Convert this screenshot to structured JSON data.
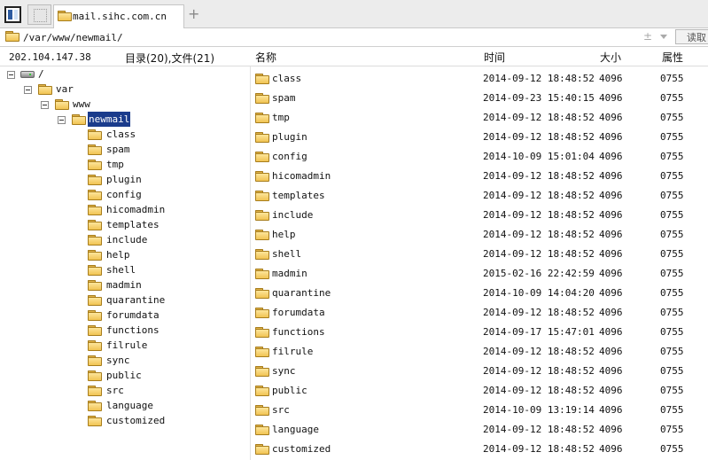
{
  "tabs": {
    "active_title": "mail.sihc.com.cn",
    "new_tab_glyph": "+"
  },
  "address": {
    "path": "/var/www/newmail/",
    "plus_minus": "±",
    "read_button": "读取"
  },
  "header": {
    "ip": "202.104.147.38",
    "counts": "目录(20),文件(21)",
    "col_name": "名称",
    "col_time": "时间",
    "col_size": "大小",
    "col_perm": "属性"
  },
  "tree": {
    "root": "/",
    "var": "var",
    "www": "www",
    "newmail": "newmail",
    "children": [
      "class",
      "spam",
      "tmp",
      "plugin",
      "config",
      "hicomadmin",
      "templates",
      "include",
      "help",
      "shell",
      "madmin",
      "quarantine",
      "forumdata",
      "functions",
      "filrule",
      "sync",
      "public",
      "src",
      "language",
      "customized"
    ]
  },
  "files": [
    {
      "name": "class",
      "time": "2014-09-12 18:48:52",
      "size": "4096",
      "perm": "0755"
    },
    {
      "name": "spam",
      "time": "2014-09-23 15:40:15",
      "size": "4096",
      "perm": "0755"
    },
    {
      "name": "tmp",
      "time": "2014-09-12 18:48:52",
      "size": "4096",
      "perm": "0755"
    },
    {
      "name": "plugin",
      "time": "2014-09-12 18:48:52",
      "size": "4096",
      "perm": "0755"
    },
    {
      "name": "config",
      "time": "2014-10-09 15:01:04",
      "size": "4096",
      "perm": "0755"
    },
    {
      "name": "hicomadmin",
      "time": "2014-09-12 18:48:52",
      "size": "4096",
      "perm": "0755"
    },
    {
      "name": "templates",
      "time": "2014-09-12 18:48:52",
      "size": "4096",
      "perm": "0755"
    },
    {
      "name": "include",
      "time": "2014-09-12 18:48:52",
      "size": "4096",
      "perm": "0755"
    },
    {
      "name": "help",
      "time": "2014-09-12 18:48:52",
      "size": "4096",
      "perm": "0755"
    },
    {
      "name": "shell",
      "time": "2014-09-12 18:48:52",
      "size": "4096",
      "perm": "0755"
    },
    {
      "name": "madmin",
      "time": "2015-02-16 22:42:59",
      "size": "4096",
      "perm": "0755"
    },
    {
      "name": "quarantine",
      "time": "2014-10-09 14:04:20",
      "size": "4096",
      "perm": "0755"
    },
    {
      "name": "forumdata",
      "time": "2014-09-12 18:48:52",
      "size": "4096",
      "perm": "0755"
    },
    {
      "name": "functions",
      "time": "2014-09-17 15:47:01",
      "size": "4096",
      "perm": "0755"
    },
    {
      "name": "filrule",
      "time": "2014-09-12 18:48:52",
      "size": "4096",
      "perm": "0755"
    },
    {
      "name": "sync",
      "time": "2014-09-12 18:48:52",
      "size": "4096",
      "perm": "0755"
    },
    {
      "name": "public",
      "time": "2014-09-12 18:48:52",
      "size": "4096",
      "perm": "0755"
    },
    {
      "name": "src",
      "time": "2014-10-09 13:19:14",
      "size": "4096",
      "perm": "0755"
    },
    {
      "name": "language",
      "time": "2014-09-12 18:48:52",
      "size": "4096",
      "perm": "0755"
    },
    {
      "name": "customized",
      "time": "2014-09-12 18:48:52",
      "size": "4096",
      "perm": "0755"
    }
  ]
}
